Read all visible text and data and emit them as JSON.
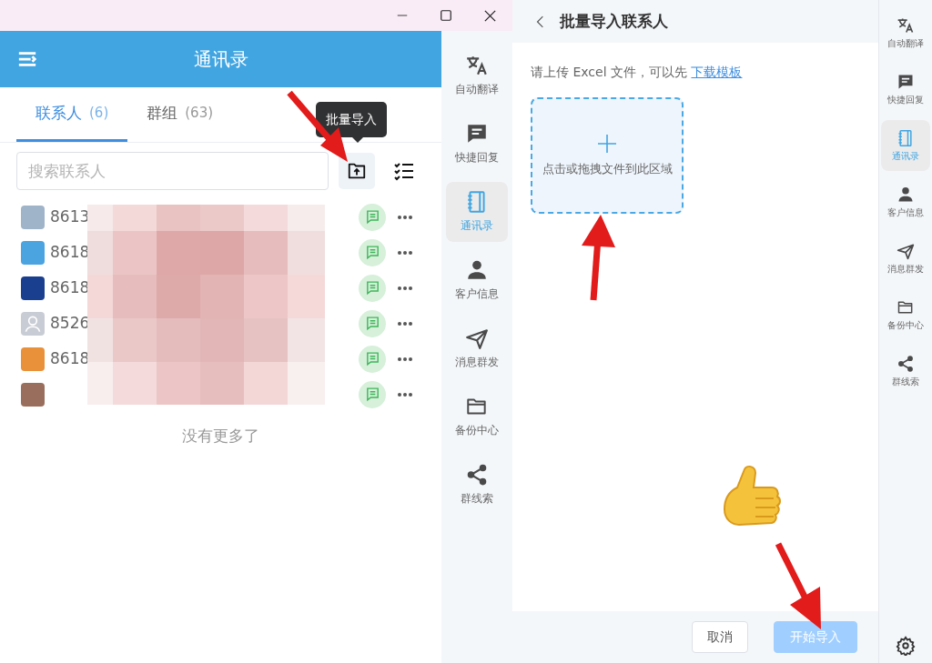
{
  "header": {
    "title": "通讯录"
  },
  "tabs": [
    {
      "label": "联系人",
      "count": "(6)",
      "selected": true
    },
    {
      "label": "群组",
      "count": "(63)",
      "selected": false
    }
  ],
  "search": {
    "placeholder": "搜索联系人"
  },
  "tooltip": "批量导入",
  "contacts": [
    {
      "name": "8613",
      "kind": "photo"
    },
    {
      "name": "8618",
      "kind": "photo"
    },
    {
      "name": "8618",
      "kind": "photo"
    },
    {
      "name": "8526",
      "kind": "default"
    },
    {
      "name": "8618",
      "kind": "photo"
    },
    {
      "kind": "photo"
    }
  ],
  "list_end": "没有更多了",
  "sidebar": {
    "items": [
      {
        "label": "自动翻译",
        "selected": false
      },
      {
        "label": "快捷回复",
        "selected": false
      },
      {
        "label": "通讯录",
        "selected": true
      },
      {
        "label": "客户信息",
        "selected": false
      },
      {
        "label": "消息群发",
        "selected": false
      },
      {
        "label": "备份中心",
        "selected": false
      },
      {
        "label": "群线索",
        "selected": false
      }
    ]
  },
  "import_panel": {
    "title": "批量导入联系人",
    "hint": "请上传 Excel 文件，可以先",
    "link": "下载模板",
    "dropzone": "点击或拖拽文件到此区域",
    "buttons": [
      {
        "label": "取消",
        "kind": "secondary",
        "disabled": false
      },
      {
        "label": "开始导入",
        "kind": "primary",
        "disabled": true
      }
    ]
  },
  "right_sidebar": {
    "items": [
      {
        "label": "自动翻译",
        "selected": false
      },
      {
        "label": "快捷回复",
        "selected": false
      },
      {
        "label": "通讯录",
        "selected": true
      },
      {
        "label": "客户信息",
        "selected": false
      },
      {
        "label": "消息群发",
        "selected": false
      },
      {
        "label": "备份中心",
        "selected": false
      },
      {
        "label": "群线索",
        "selected": false
      }
    ]
  }
}
